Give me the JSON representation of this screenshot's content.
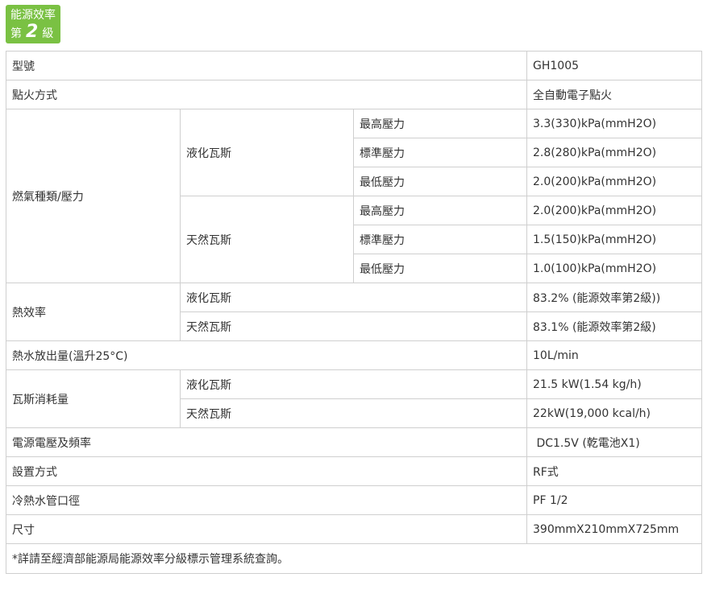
{
  "badge": {
    "line1": "能源效率",
    "prefix": "第",
    "grade": "2",
    "suffix": "級",
    "color": "#7ac143"
  },
  "table": {
    "model": {
      "label": "型號",
      "value": "GH1005"
    },
    "ignition": {
      "label": "點火方式",
      "value": "全自動電子點火"
    },
    "gas": {
      "label": "燃氣種類/壓力",
      "lpg": {
        "label": "液化瓦斯",
        "rows": [
          {
            "label": "最高壓力",
            "value": "3.3(330)kPa(mmH2O)"
          },
          {
            "label": "標準壓力",
            "value": "2.8(280)kPa(mmH2O)"
          },
          {
            "label": "最低壓力",
            "value": "2.0(200)kPa(mmH2O)"
          }
        ]
      },
      "ng": {
        "label": "天然瓦斯",
        "rows": [
          {
            "label": "最高壓力",
            "value": "2.0(200)kPa(mmH2O)"
          },
          {
            "label": "標準壓力",
            "value": "1.5(150)kPa(mmH2O)"
          },
          {
            "label": "最低壓力",
            "value": "1.0(100)kPa(mmH2O)"
          }
        ]
      }
    },
    "efficiency": {
      "label": "熱效率",
      "lpg": {
        "label": "液化瓦斯",
        "value": "83.2% (能源效率第2級))"
      },
      "ng": {
        "label": "天然瓦斯",
        "value": "83.1% (能源效率第2級)"
      }
    },
    "hot_water": {
      "label": "熱水放出量(溫升25°C)",
      "value": "10L/min"
    },
    "consumption": {
      "label": "瓦斯消耗量",
      "lpg": {
        "label": "液化瓦斯",
        "value": "21.5 kW(1.54 kg/h)"
      },
      "ng": {
        "label": "天然瓦斯",
        "value": "22kW(19,000 kcal/h)"
      }
    },
    "power": {
      "label": "電源電壓及頻率",
      "value": " DC1.5V (乾電池X1)"
    },
    "install": {
      "label": "設置方式",
      "value": "RF式"
    },
    "pipe": {
      "label": "冷熱水管口徑",
      "value": "PF 1/2"
    },
    "size": {
      "label": "尺寸",
      "value": "390mmX210mmX725mm"
    },
    "note": "*詳請至經濟部能源局能源效率分級標示管理系統查詢。"
  }
}
